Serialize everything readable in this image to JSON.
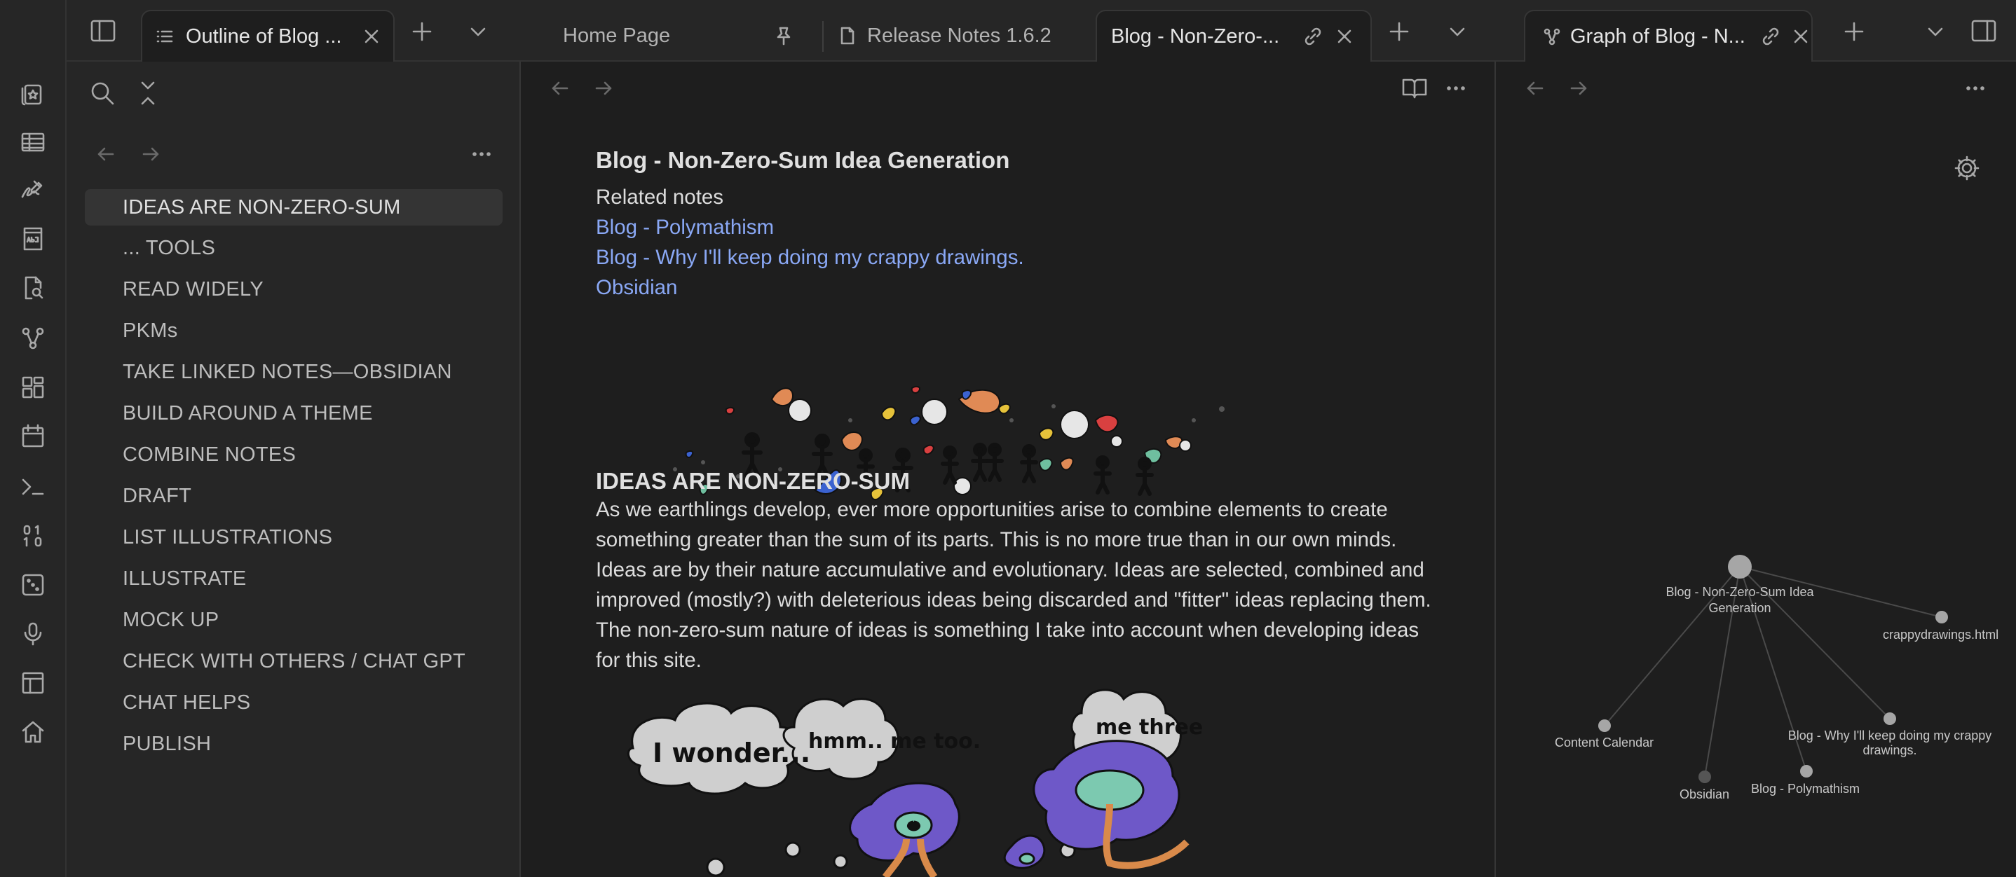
{
  "left_tabs": [
    {
      "label": "Outline of Blog ...",
      "icon": "list-icon",
      "active": true
    }
  ],
  "center_tabs": [
    {
      "label": "Home Page",
      "pinned": true
    },
    {
      "label": "Release Notes 1.6.2",
      "icon": "file-icon"
    },
    {
      "label": "Blog - Non-Zero-...",
      "active": true
    }
  ],
  "right_tabs": [
    {
      "label": "Graph of Blog - N...",
      "icon": "graph-icon",
      "active": true
    }
  ],
  "ribbon_icons": [
    "cards-icon",
    "table-icon",
    "signature-icon",
    "dictionary-icon",
    "file-search-icon",
    "graph-icon",
    "dashboard-icon",
    "calendar-icon",
    "terminal-icon",
    "binary-icon",
    "dice-icon",
    "microphone-icon",
    "layout-icon",
    "home-icon"
  ],
  "outline": {
    "items": [
      "IDEAS ARE NON-ZERO-SUM",
      "... TOOLS",
      "READ WIDELY",
      "PKMs",
      "TAKE LINKED NOTES—OBSIDIAN",
      "BUILD AROUND A THEME",
      "COMBINE NOTES",
      "DRAFT",
      "LIST ILLUSTRATIONS",
      "ILLUSTRATE",
      "MOCK UP",
      "CHECK WITH OTHERS / CHAT GPT",
      "CHAT HELPS",
      "PUBLISH"
    ]
  },
  "note": {
    "title": "Blog - Non-Zero-Sum Idea Generation",
    "related_label": "Related notes",
    "links": [
      "Blog - Polymathism",
      "Blog - Why I'll keep doing my crappy drawings.",
      "Obsidian"
    ],
    "heading": "IDEAS ARE NON-ZERO-SUM",
    "paragraph": "As we earthlings develop, ever more opportunities arise to combine elements to create something greater than the sum of its parts. This is no more true than in our own minds. Ideas are by their nature accumulative and evolutionary. Ideas are selected, combined and improved (mostly?) with deleterious ideas being discarded and \"fitter\" ideas replacing them. The non-zero-sum nature of ideas is something I take into account when developing ideas for this site.",
    "bubbles": [
      "I wonder...",
      "hmm.. me too.",
      "me three"
    ]
  },
  "graph": {
    "nodes": [
      {
        "label": "Blog - Non-Zero-Sum Idea Generation"
      },
      {
        "label": "crappydrawings.html"
      },
      {
        "label": "Blog - Why I'll keep doing my crappy drawings."
      },
      {
        "label": "Content Calendar"
      },
      {
        "label": "Obsidian"
      },
      {
        "label": "Blog - Polymathism"
      }
    ]
  },
  "colors": {
    "background": "#1e1e1e",
    "sidebar": "#262626",
    "link": "#8aa8f5",
    "accent": "#7a6ae0"
  }
}
